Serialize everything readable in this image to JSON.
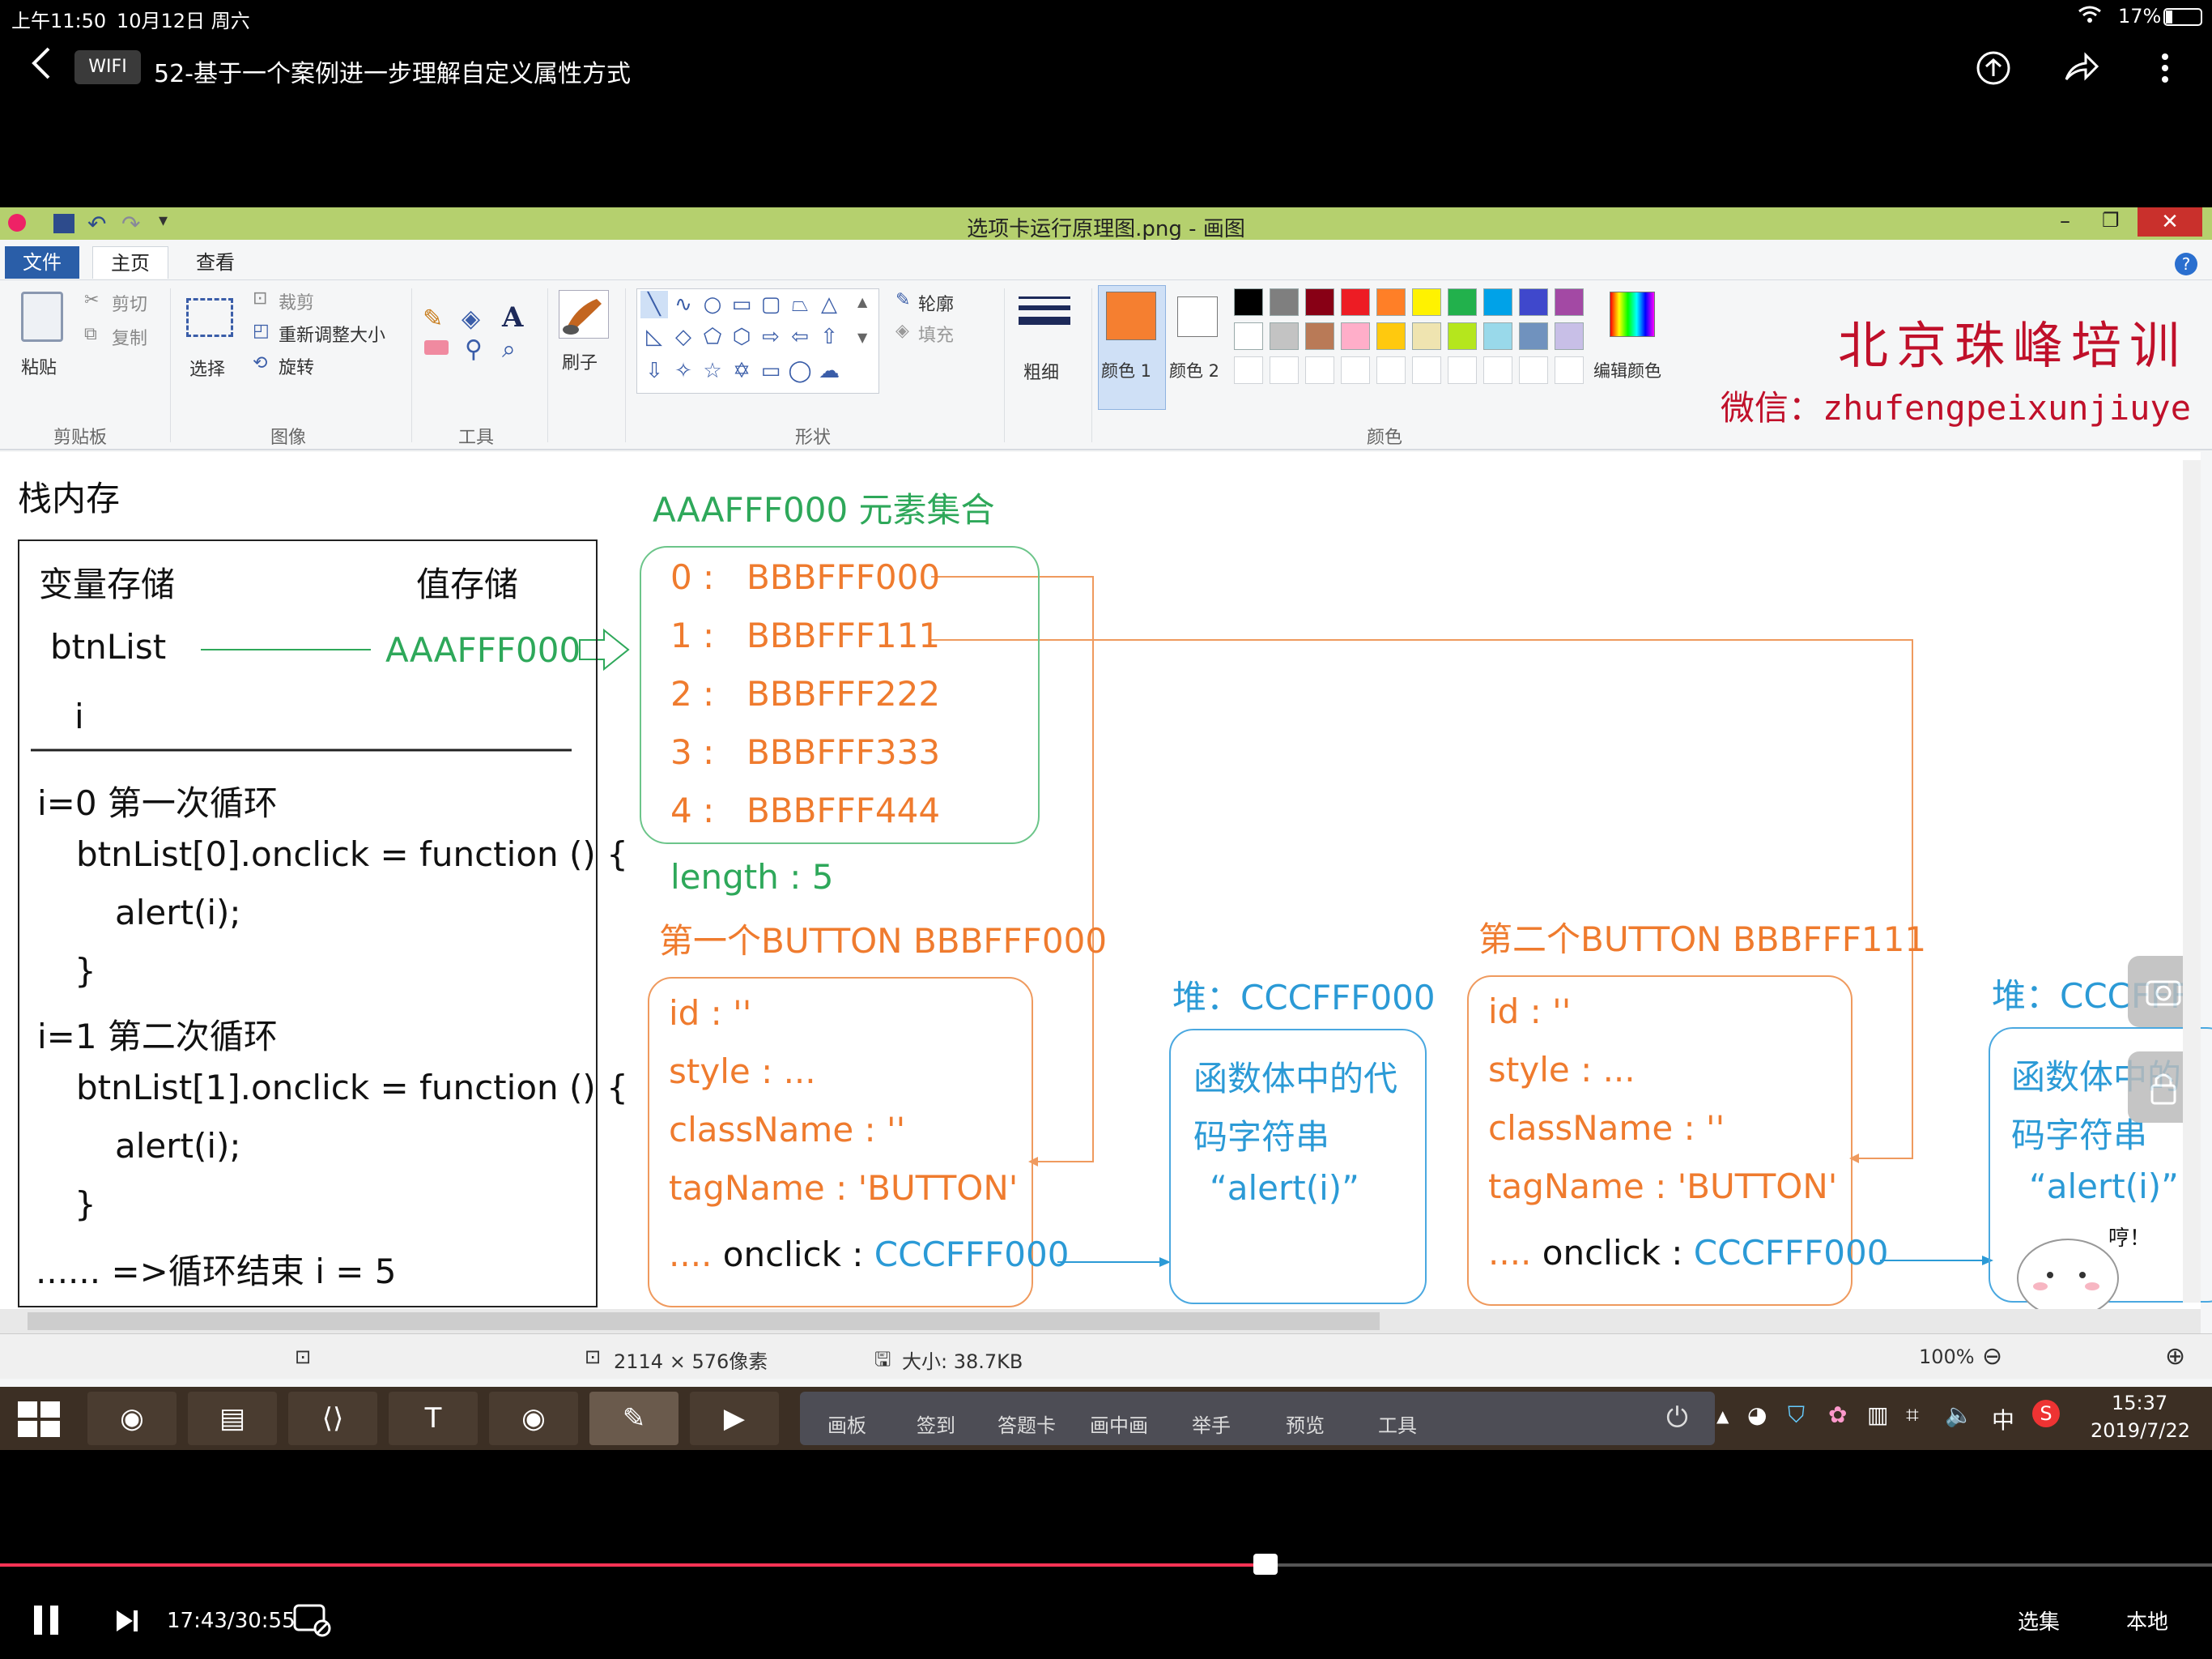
{
  "status": {
    "time": "上午11:50",
    "date": "10月12日 周六",
    "battery": "17%"
  },
  "video": {
    "back_icon": "chevron-left-icon",
    "badge": "WIFI",
    "title": "52-基于一个案例进一步理解自定义属性方式"
  },
  "paint": {
    "window_title": "选项卡运行原理图.png - 画图",
    "tabs": [
      "文件",
      "主页",
      "查看"
    ],
    "ribbon": {
      "clipboard": {
        "paste": "粘贴",
        "cut": "剪切",
        "copy": "复制",
        "label": "剪贴板"
      },
      "image": {
        "select": "选择",
        "crop": "裁剪",
        "resize": "重新调整大小",
        "rotate": "旋转",
        "label": "图像"
      },
      "tools": {
        "label": "工具"
      },
      "brush": "刷子",
      "shapes": {
        "outline": "轮廓",
        "fill": "填充",
        "label": "形状"
      },
      "size": "粗细",
      "color1": "颜色 1",
      "color2": "颜色 2",
      "edit_colors": "编辑颜色",
      "colors_label": "颜色"
    },
    "palette_row1": [
      "#000000",
      "#7f7f7f",
      "#880015",
      "#ed1c24",
      "#ff7f27",
      "#fff200",
      "#22b14c",
      "#00a2e8",
      "#3f48cc",
      "#a349a4"
    ],
    "palette_row2": [
      "#ffffff",
      "#c3c3c3",
      "#b97a57",
      "#ffaec9",
      "#ffc90e",
      "#efe4b0",
      "#b5e61d",
      "#99d9ea",
      "#7092be",
      "#c8bfe7"
    ],
    "color1_value": "#f57f30",
    "watermark": {
      "line1": "北京珠峰培训",
      "line2": "微信：zhufengpeixunjiuye"
    },
    "statusbar": {
      "dimensions": "2114 × 576像素",
      "size": "大小: 38.7KB",
      "zoom": "100%"
    }
  },
  "diagram": {
    "stack_title": "栈内存",
    "var_header": "变量存储",
    "val_header": "值存储",
    "var_btnlist": "btnList",
    "val_btnlist": "AAAFFF000",
    "var_i": "i",
    "loop": [
      "i=0  第一次循环",
      "btnList[0].onclick = function () {",
      "alert(i);",
      "}",
      "i=1 第二次循环",
      "btnList[1].onclick = function () {",
      "alert(i);",
      "}",
      "......   =>循环结束 i = 5"
    ],
    "collection_title": "AAAFFF000 元素集合",
    "collection": [
      {
        "idx": "0",
        "sep": ":",
        "addr": "BBBFFF000"
      },
      {
        "idx": "1",
        "sep": ":",
        "addr": "BBBFFF111"
      },
      {
        "idx": "2",
        "sep": ":",
        "addr": "BBBFFF222"
      },
      {
        "idx": "3",
        "sep": ":",
        "addr": "BBBFFF333"
      },
      {
        "idx": "4",
        "sep": ":",
        "addr": "BBBFFF444"
      }
    ],
    "collection_length": "length  :  5",
    "button1_title": "第一个BUTTON    BBBFFF000",
    "button2_title": "第二个BUTTON    BBBFFF111",
    "button_props": [
      "id : ''",
      "style : ...",
      "className : ''",
      "tagName : 'BUTTON'"
    ],
    "onclick_prefix": "....",
    "onclick_label": "onclick :",
    "onclick_value": "CCCFFF000",
    "heap1_title": "堆：CCCFFF000",
    "heap2_title": "堆：CCCFFF",
    "heap_body": [
      "函数体中的代",
      "码字符串",
      "“alert(i)”"
    ],
    "heap2_body": [
      "函数体中的",
      "码字符串",
      "“alert(i)”"
    ],
    "sticker_text": "哼！"
  },
  "taskbar": {
    "tools": [
      "画板",
      "签到",
      "答题卡",
      "画中画",
      "举手",
      "预览",
      "工具"
    ],
    "clock_time": "15:37",
    "clock_date": "2019/7/22",
    "ime": "中"
  },
  "player": {
    "time": "17:43/30:55",
    "progress": 0.572,
    "episodes": "选集",
    "local": "本地"
  }
}
